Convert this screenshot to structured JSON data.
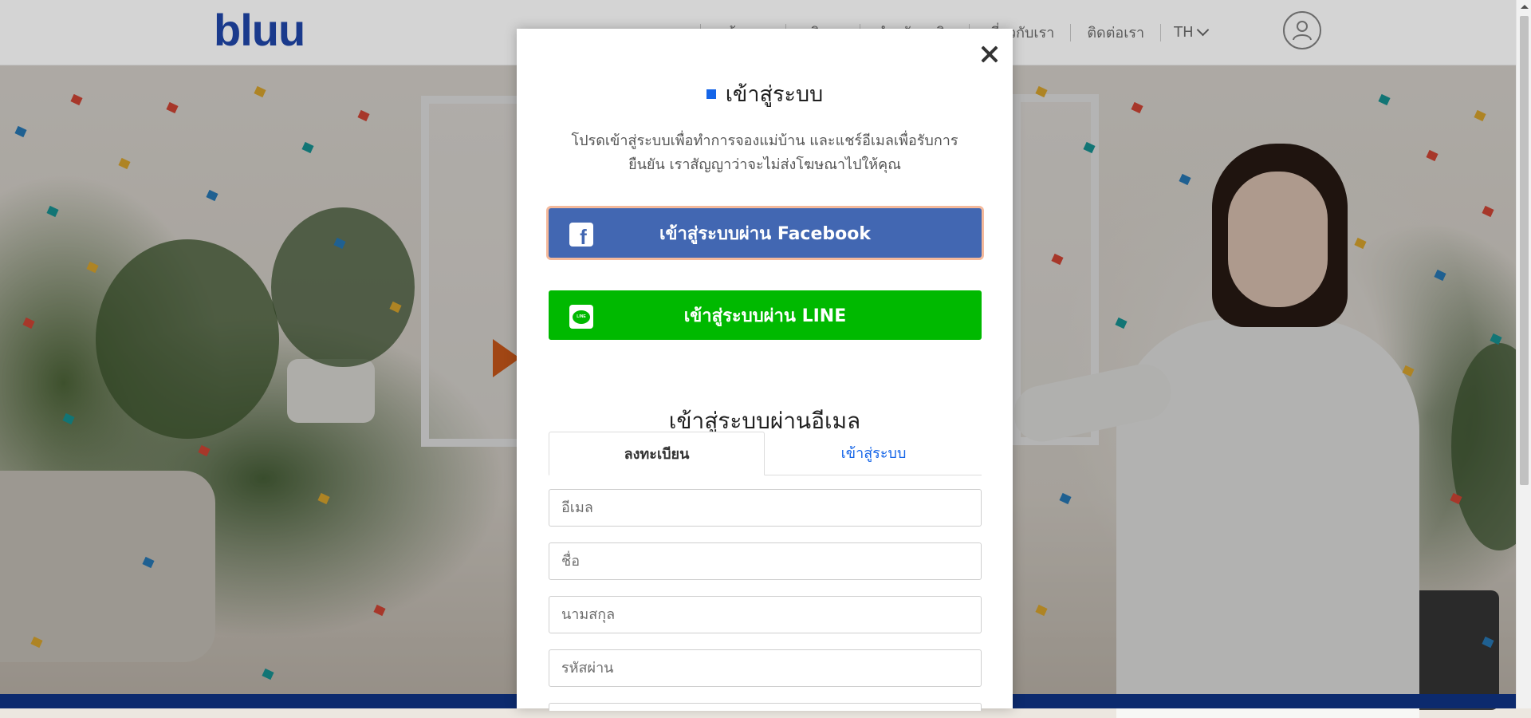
{
  "header": {
    "logo_text": "bluu",
    "nav_items": [
      "หน้าแรก",
      "บริการ",
      "สำหรับธุรกิจ",
      "เกี่ยวกับเรา",
      "ติดต่อเรา"
    ],
    "language": "TH"
  },
  "modal": {
    "title": "เข้าสู่ระบบ",
    "description": "โปรดเข้าสู่ระบบเพื่อทำการจองแม่บ้าน และแชร์อีเมลเพื่อรับการยืนยัน เราสัญญาว่าจะไม่ส่งโฆษณาไปให้คุณ",
    "facebook_button": "เข้าสู่ระบบผ่าน Facebook",
    "line_button": "เข้าสู่ระบบผ่าน LINE",
    "line_icon_text": "LINE",
    "email_heading": "เข้าสู่ระบบผ่านอีเมล",
    "tabs": [
      {
        "label": "ลงทะเบียน",
        "active": true
      },
      {
        "label": "เข้าสู่ระบบ",
        "active": false
      }
    ],
    "fields": {
      "email_placeholder": "อีเมล",
      "first_name_placeholder": "ชื่อ",
      "last_name_placeholder": "นามสกุล",
      "password_placeholder": "รหัสผ่าน"
    }
  },
  "colors": {
    "facebook": "#4267b2",
    "line": "#00b900",
    "accent": "#1565e8",
    "brand": "#1a3a8c"
  },
  "icons": [
    "close-icon",
    "facebook-icon",
    "line-icon",
    "chevron-down-icon",
    "user-icon"
  ]
}
